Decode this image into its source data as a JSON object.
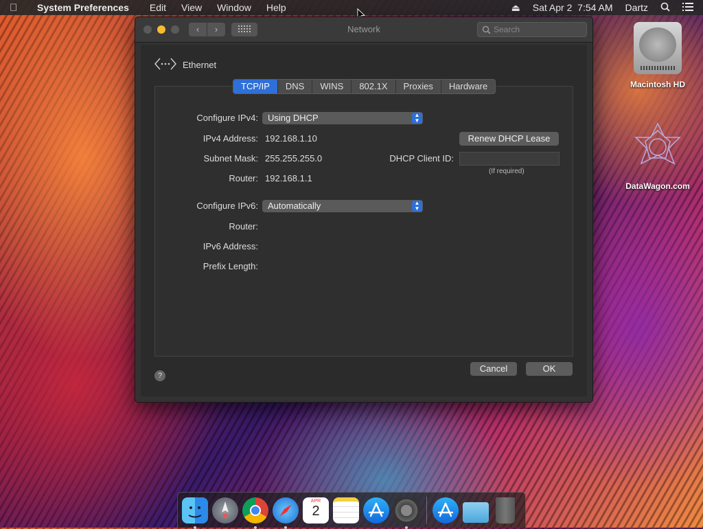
{
  "menubar": {
    "app": "System Preferences",
    "items": [
      "Edit",
      "View",
      "Window",
      "Help"
    ],
    "clock": "Sat Apr 2  7:54 AM",
    "user": "Dartz"
  },
  "window": {
    "title": "Network",
    "search_placeholder": "Search",
    "interface": "Ethernet",
    "tabs": [
      "TCP/IP",
      "DNS",
      "WINS",
      "802.1X",
      "Proxies",
      "Hardware"
    ],
    "ipv4": {
      "configure_label": "Configure IPv4:",
      "configure_value": "Using DHCP",
      "address_label": "IPv4 Address:",
      "address_value": "192.168.1.10",
      "subnet_label": "Subnet Mask:",
      "subnet_value": "255.255.255.0",
      "router_label": "Router:",
      "router_value": "192.168.1.1",
      "renew_button": "Renew DHCP Lease",
      "dhcp_client_label": "DHCP Client ID:",
      "dhcp_client_value": "",
      "dhcp_hint": "(If required)"
    },
    "ipv6": {
      "configure_label": "Configure IPv6:",
      "configure_value": "Automatically",
      "router_label": "Router:",
      "address_label": "IPv6 Address:",
      "prefix_label": "Prefix Length:"
    },
    "help": "?",
    "cancel": "Cancel",
    "ok": "OK"
  },
  "desktop": {
    "icons": [
      "Macintosh HD",
      "DataWagon.com"
    ]
  },
  "dock": {
    "apps": [
      "finder-icon",
      "launchpad-icon",
      "chrome-icon",
      "safari-icon",
      "calendar-icon",
      "notes-icon",
      "app-store-icon",
      "system-preferences-icon",
      "app-store-download-icon",
      "downloads-folder-icon",
      "trash-icon"
    ],
    "calendar_month": "APR",
    "calendar_day": "2"
  },
  "colors": {
    "accent": "#2f6fd8",
    "window_bg": "#323232"
  }
}
